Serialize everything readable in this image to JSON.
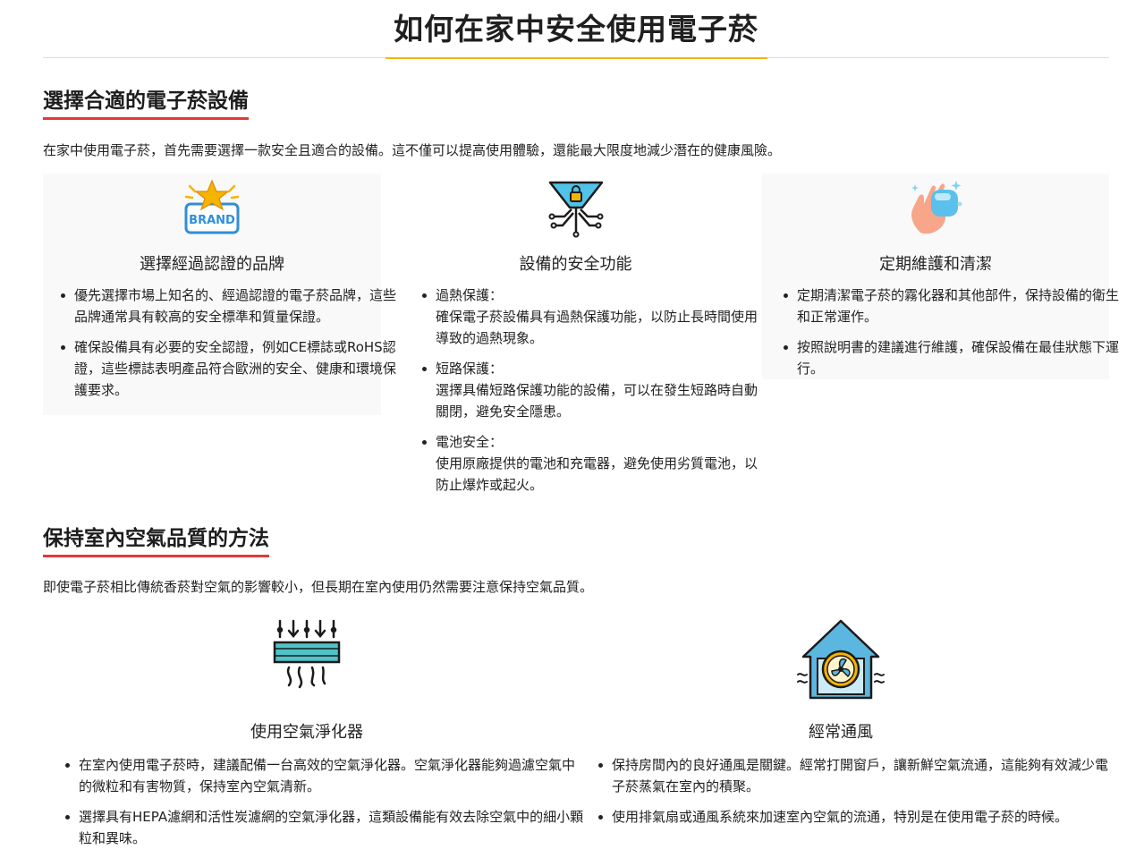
{
  "title": "如何在家中安全使用電子菸",
  "section1": {
    "heading": "選擇合適的電子菸設備",
    "intro": "在家中使用電子菸，首先需要選擇一款安全且適合的設備。這不僅可以提高使用體驗，還能最大限度地減少潛在的健康風險。",
    "cards": [
      {
        "icon": "brand-star-icon",
        "title": "選擇經過認證的品牌",
        "icon_text": "BRAND",
        "items": [
          "優先選擇市場上知名的、經過認證的電子菸品牌，這些品牌通常具有較高的安全標準和質量保證。",
          "確保設備具有必要的安全認證，例如CE標誌或RoHS認證，這些標誌表明產品符合歐洲的安全、健康和環境保護要求。"
        ]
      },
      {
        "icon": "security-funnel-lock-icon",
        "title": "設備的安全功能",
        "items": [
          {
            "head": "過熱保護：",
            "body": "確保電子菸設備具有過熱保護功能，以防止長時間使用導致的過熱現象。"
          },
          {
            "head": "短路保護：",
            "body": "選擇具備短路保護功能的設備，可以在發生短路時自動關閉，避免安全隱患。"
          },
          {
            "head": "電池安全：",
            "body": "使用原廠提供的電池和充電器，避免使用劣質電池，以防止爆炸或起火。"
          }
        ]
      },
      {
        "icon": "cleaning-hand-icon",
        "title": "定期維護和清潔",
        "items": [
          "定期清潔電子菸的霧化器和其他部件，保持設備的衛生和正常運作。",
          "按照說明書的建議進行維護，確保設備在最佳狀態下運行。"
        ]
      }
    ]
  },
  "section2": {
    "heading": "保持室內空氣品質的方法",
    "intro": "即使電子菸相比傳統香菸對空氣的影響較小，但長期在室內使用仍然需要注意保持空氣品質。",
    "cards": [
      {
        "icon": "air-purifier-icon",
        "title": "使用空氣淨化器",
        "items": [
          "在室內使用電子菸時，建議配備一台高效的空氣淨化器。空氣淨化器能夠過濾空氣中的微粒和有害物質，保持室內空氣清新。",
          "選擇具有HEPA濾網和活性炭濾網的空氣淨化器，這類設備能有效去除空氣中的細小顆粒和異味。"
        ]
      },
      {
        "icon": "house-ventilation-fan-icon",
        "title": "經常通風",
        "items": [
          "保持房間內的良好通風是關鍵。經常打開窗戶，讓新鮮空氣流通，這能夠有效減少電子菸蒸氣在室內的積聚。",
          "使用排氣扇或通風系統來加速室內空氣的流通，特別是在使用電子菸的時候。"
        ]
      }
    ]
  }
}
